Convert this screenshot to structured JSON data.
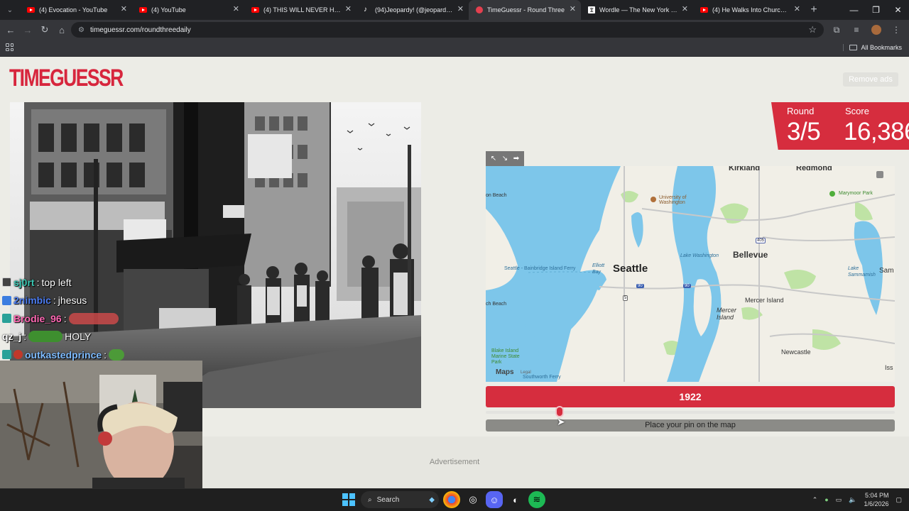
{
  "browser": {
    "tabs": [
      {
        "title": "(4) Evocation - YouTube",
        "icon": "youtube-icon",
        "active": false
      },
      {
        "title": "(4) YouTube",
        "icon": "youtube-icon",
        "active": false
      },
      {
        "title": "(4) THIS WILL NEVER HAPPEN A",
        "icon": "youtube-icon",
        "active": false
      },
      {
        "title": "(94)Jeopardy! (@jeopardy) Offi",
        "icon": "tiktok-icon",
        "active": false
      },
      {
        "title": "TimeGuessr - Round Three",
        "icon": "timeguessr-icon",
        "active": true
      },
      {
        "title": "Wordle — The New York Times",
        "icon": "nyt-icon",
        "active": false
      },
      {
        "title": "(4) He Walks Into Church Claim",
        "icon": "youtube-icon",
        "active": false
      }
    ],
    "url": "timeguessr.com/roundthreedaily",
    "bookmarks_label": "All Bookmarks"
  },
  "page": {
    "logo": "TIMEGUESSR",
    "remove_ads": "Remove ads",
    "round_label": "Round",
    "round_value": "3/5",
    "score_label": "Score",
    "score_value": "16,386",
    "year": "1922",
    "place_pin": "Place your pin on the map",
    "advertisement": "Advertisement",
    "map": {
      "labels": {
        "kirkland": "Kirkland",
        "redmond": "Redmond",
        "uw": "University of Washington",
        "marymoor": "Marymoor Park",
        "seattle": "Seattle",
        "bellevue": "Bellevue",
        "lake_washington": "Lake Washington",
        "lake_sammamish": "Lake Sammamish",
        "sam": "Sam",
        "elliott_bay": "Elliott Bay",
        "ferry": "Seattle - Bainbridge Island Ferry",
        "mercer_island_a": "Mercer Island",
        "mercer_island_b": "Mercer Island",
        "newcastle": "Newcastle",
        "blake": "Blake Island Marine State Park",
        "southworth": "Southworth Ferry",
        "beach_top": "on Beach",
        "beach_mid": "ch Beach",
        "iss": "Iss",
        "attribution": "Maps",
        "legal": "Legal"
      },
      "shields": [
        "405",
        "90",
        "90",
        "5"
      ]
    }
  },
  "stream": {
    "chat": [
      {
        "user": "sj0rt",
        "text": "top left",
        "color": "#3ac6b2"
      },
      {
        "user": "2nimbic",
        "text": "jhesus",
        "color": "#4d7df2"
      },
      {
        "user": "Brodie_96",
        "text": "",
        "color": "#ff69b4"
      },
      {
        "user": "qz_j",
        "text": "HOLY",
        "color": "#ffffff"
      },
      {
        "user": "outkastedprince",
        "text": "",
        "color": "#7fbcff"
      }
    ]
  },
  "taskbar": {
    "search": "Search",
    "time": "5:04 PM",
    "date": "1/6/2026"
  },
  "colors": {
    "accent": "#d62d3e",
    "page_bg": "#ecece6",
    "water": "#7dc6ea"
  }
}
